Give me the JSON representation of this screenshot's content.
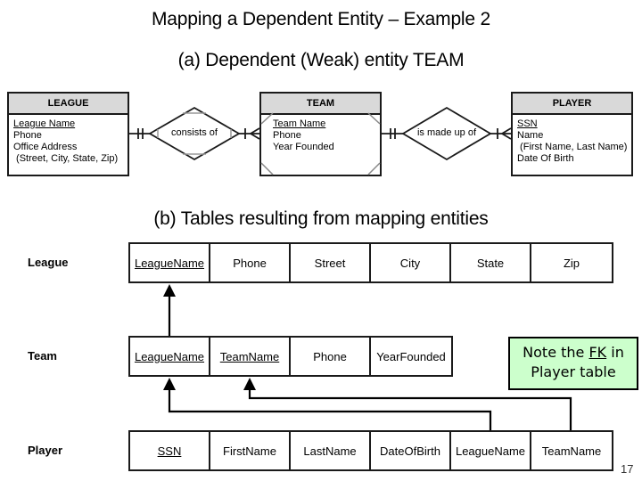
{
  "slide": {
    "title": "Mapping a Dependent Entity – Example 2",
    "subtitle_a": "(a) Dependent (Weak) entity TEAM",
    "subtitle_b": "(b) Tables resulting from mapping entities",
    "page_number": "17"
  },
  "er_diagram": {
    "entities": [
      {
        "name": "LEAGUE",
        "weak": false,
        "attributes": [
          {
            "text": "League Name",
            "key": true
          },
          {
            "text": "Phone",
            "key": false
          },
          {
            "text": "Office Address",
            "key": false
          },
          {
            "text": " (Street, City, State, Zip)",
            "key": false
          }
        ]
      },
      {
        "name": "TEAM",
        "weak": true,
        "attributes": [
          {
            "text": "Team Name",
            "key": true
          },
          {
            "text": "Phone",
            "key": false
          },
          {
            "text": "Year Founded",
            "key": false
          }
        ]
      },
      {
        "name": "PLAYER",
        "weak": false,
        "attributes": [
          {
            "text": "SSN",
            "key": true
          },
          {
            "text": "Name",
            "key": false
          },
          {
            "text": " (First Name, Last Name)",
            "key": false
          },
          {
            "text": "Date Of Birth",
            "key": false
          }
        ]
      }
    ],
    "relationships": [
      {
        "label": "consists of",
        "from": "LEAGUE",
        "to": "TEAM",
        "identifying": true,
        "from_cardinality": "one-and-only-one",
        "to_cardinality": "one-or-many"
      },
      {
        "label": "is made up of",
        "from": "TEAM",
        "to": "PLAYER",
        "identifying": false,
        "from_cardinality": "one-and-only-one",
        "to_cardinality": "one-or-many"
      }
    ]
  },
  "tables": [
    {
      "name": "League",
      "columns": [
        {
          "name": "LeagueName",
          "pk": true
        },
        {
          "name": "Phone",
          "pk": false
        },
        {
          "name": "Street",
          "pk": false
        },
        {
          "name": "City",
          "pk": false
        },
        {
          "name": "State",
          "pk": false
        },
        {
          "name": "Zip",
          "pk": false
        }
      ]
    },
    {
      "name": "Team",
      "columns": [
        {
          "name": "LeagueName",
          "pk": true
        },
        {
          "name": "TeamName",
          "pk": true
        },
        {
          "name": "Phone",
          "pk": false
        },
        {
          "name": "YearFounded",
          "pk": false
        }
      ]
    },
    {
      "name": "Player",
      "columns": [
        {
          "name": "SSN",
          "pk": true
        },
        {
          "name": "FirstName",
          "pk": false
        },
        {
          "name": "LastName",
          "pk": false
        },
        {
          "name": "DateOfBirth",
          "pk": false
        },
        {
          "name": "LeagueName",
          "pk": false
        },
        {
          "name": "TeamName",
          "pk": false
        }
      ]
    }
  ],
  "foreign_keys": [
    {
      "from": "Team.LeagueName",
      "to": "League.LeagueName"
    },
    {
      "from": "Player.LeagueName",
      "to": "Team.LeagueName"
    },
    {
      "from": "Player.TeamName",
      "to": "Team.TeamName"
    }
  ],
  "note": {
    "prefix": "Note the ",
    "emphasis": "FK",
    "suffix": " in",
    "line2": "Player table",
    "background": "#ccffcc"
  }
}
